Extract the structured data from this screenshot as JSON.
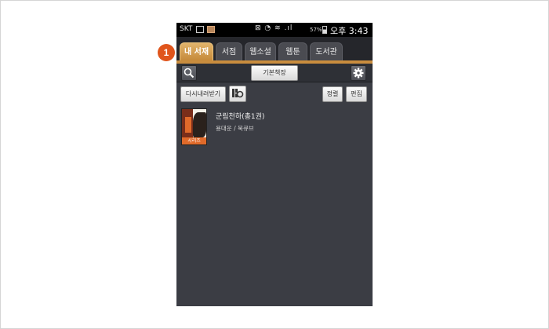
{
  "statusbar": {
    "carrier": "SKT",
    "icons": "⊠ ◔ ≋ .ıl",
    "battery": "57%",
    "time": "오후 3:43"
  },
  "tabs": [
    {
      "label": "내 서재",
      "active": true
    },
    {
      "label": "서점",
      "active": false
    },
    {
      "label": "웹소설",
      "active": false
    },
    {
      "label": "웹툰",
      "active": false
    },
    {
      "label": "도서관",
      "active": false
    }
  ],
  "toolbar": {
    "shelf_label": "기본책장",
    "redownload_label": "다시내려받기",
    "sort_label": "정렬",
    "edit_label": "편집"
  },
  "books": [
    {
      "title": "군림천하(총1권)",
      "author": "용대운 / 북큐브",
      "badge": "시리즈"
    }
  ],
  "callout": {
    "number": "1"
  },
  "colors": {
    "accent": "#c98d3e",
    "marker": "#e0551c",
    "background": "#3b3d44"
  }
}
